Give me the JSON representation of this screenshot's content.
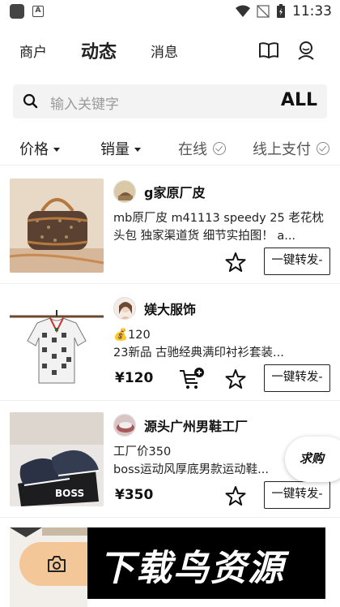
{
  "status_bar": {
    "time": "11:33"
  },
  "top_nav": {
    "tabs": [
      {
        "label": "商户"
      },
      {
        "label": "动态"
      },
      {
        "label": "消息"
      }
    ]
  },
  "search": {
    "placeholder": "输入关键字",
    "all_label": "ALL"
  },
  "filters": [
    {
      "label": "价格"
    },
    {
      "label": "销量"
    },
    {
      "label": "在线"
    },
    {
      "label": "线上支付"
    }
  ],
  "feed": [
    {
      "seller": "g家原厂皮",
      "desc": "mb原厂皮  m41113 speedy 25 老花枕头包 独家渠道货 细节实拍图！ a...",
      "forward_label": "一键转发-"
    },
    {
      "seller": "媄大服饰",
      "coin_text": "💰120",
      "desc": "23新品 古驰经典满印衬衫套装...",
      "price": "¥120",
      "forward_label": "一键转发-"
    },
    {
      "seller": "源头广州男鞋工厂",
      "line1": "工厂价350",
      "desc": "boss运动风厚底男款运动鞋...",
      "price": "¥350",
      "forward_label": "一键转发-"
    }
  ],
  "ask_buy": {
    "label": "求购"
  },
  "watermark": {
    "text": "下载鸟资源"
  },
  "colors": {
    "accent_pill": "#f3c797",
    "text": "#111111",
    "muted": "#9a9a9a"
  }
}
